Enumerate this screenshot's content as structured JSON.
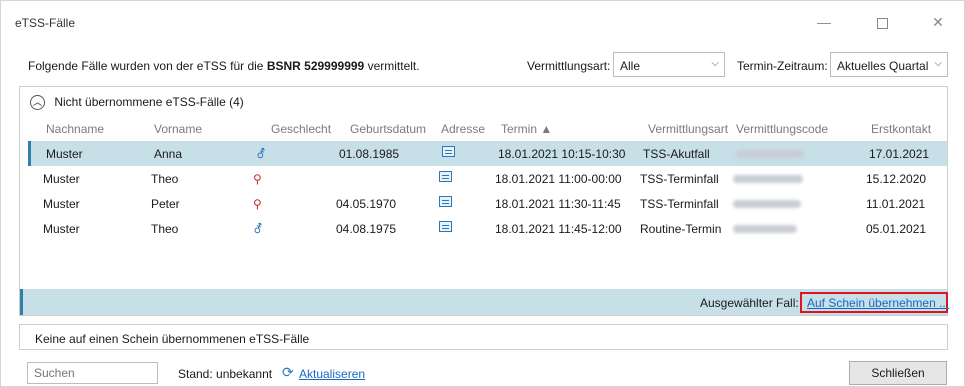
{
  "window": {
    "title": "eTSS-Fälle",
    "minimize_glyph": "—",
    "close_glyph": "✕"
  },
  "top": {
    "info_prefix": "Folgende Fälle wurden von der eTSS für die",
    "info_bsnr": "BSNR 529999999",
    "info_suffix": "vermittelt.",
    "vermittlungsart_label": "Vermittlungsart:",
    "vermittlungsart_value": "Alle",
    "zeitraum_label": "Termin-Zeitraum:",
    "zeitraum_value": "Aktuelles Quartal"
  },
  "panel": {
    "header": "Nicht  übernommene eTSS-Fälle (4)",
    "columns": [
      "Nachname",
      "Vorname",
      "Geschlecht",
      "Geburtsdatum",
      "Adresse",
      "Termin ▲",
      "Vermittlungsart",
      "Vermittlungscode",
      "Erstkontakt"
    ],
    "rows": [
      {
        "nachname": "Muster",
        "vorname": "Anna",
        "geschlecht": "⚦",
        "geburtsdatum": "01.08.1985",
        "termin": "18.01.2021 10:15-10:30",
        "vermittlungsart": "TSS-Akutfall",
        "erstkontakt": "17.01.2021"
      },
      {
        "nachname": "Muster",
        "vorname": "Theo",
        "geschlecht": "⚲",
        "geburtsdatum": "",
        "termin": "18.01.2021 11:00-00:00",
        "vermittlungsart": "TSS-Terminfall",
        "erstkontakt": "15.12.2020"
      },
      {
        "nachname": "Muster",
        "vorname": "Peter",
        "geschlecht": "⚲",
        "geburtsdatum": "04.05.1970",
        "termin": "18.01.2021 11:30-11:45",
        "vermittlungsart": "TSS-Terminfall",
        "erstkontakt": "11.01.2021"
      },
      {
        "nachname": "Muster",
        "vorname": "Theo",
        "geschlecht": "⚦",
        "geburtsdatum": "04.08.1975",
        "termin": "18.01.2021 11:45-12:00",
        "vermittlungsart": "Routine-Termin",
        "erstkontakt": "05.01.2021"
      }
    ],
    "selected_label": "Ausgewählter Fall:",
    "selected_link": "Auf Schein übernehmen ..."
  },
  "panel2": {
    "text": "Keine auf einen Schein übernommenen eTSS-Fälle"
  },
  "bottom": {
    "search_placeholder": "Suchen",
    "stand": "Stand: unbekannt",
    "refresh_label": "Aktualiseren",
    "close_label": "Schließen"
  },
  "colors": {
    "selection": "#c7dfe6",
    "accent": "#2f7fa6",
    "link": "#1769c6",
    "highlight_box": "#e0141e"
  }
}
